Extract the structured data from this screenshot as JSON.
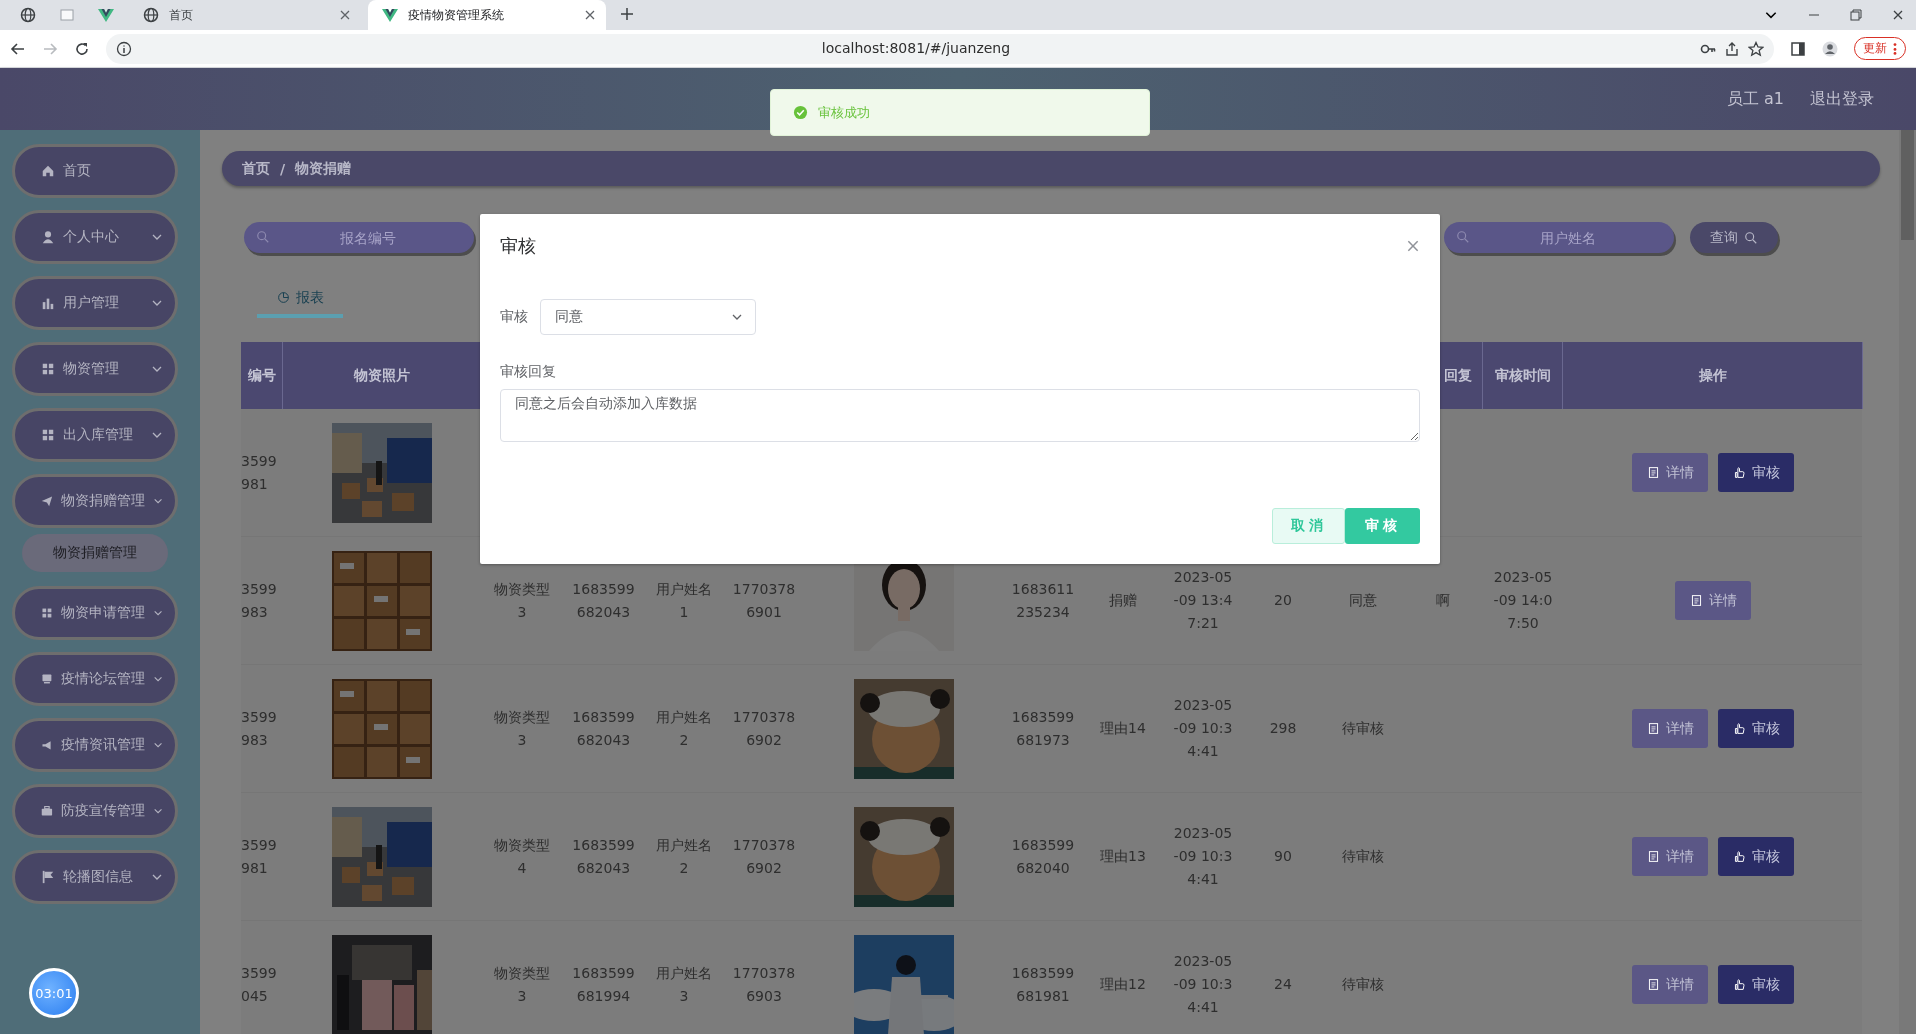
{
  "browser": {
    "tabs": [
      {
        "kind": "pinned-globe",
        "selected": false
      },
      {
        "kind": "pinned-blank",
        "selected": false
      },
      {
        "kind": "pinned-v",
        "selected": false
      },
      {
        "kind": "page",
        "title": "首页",
        "selected": false
      },
      {
        "kind": "v",
        "title": "疫情物资管理系统",
        "selected": true
      }
    ],
    "forward_disabled": true,
    "url": "localhost:8081/#/juanzeng",
    "update_button": "更新"
  },
  "header": {
    "user": "员工 a1",
    "logout": "退出登录"
  },
  "toast": {
    "message": "审核成功"
  },
  "sidebar": {
    "items": [
      {
        "label": "首页",
        "kind": "link"
      },
      {
        "label": "个人中心",
        "kind": "menu"
      },
      {
        "label": "用户管理",
        "kind": "menu"
      },
      {
        "label": "物资管理",
        "kind": "menu"
      },
      {
        "label": "出入库管理",
        "kind": "menu"
      },
      {
        "label": "物资捐赠管理",
        "kind": "menu",
        "expanded": true,
        "children": [
          {
            "label": "物资捐赠管理"
          }
        ]
      },
      {
        "label": "物资申请管理",
        "kind": "menu"
      },
      {
        "label": "疫情论坛管理",
        "kind": "menu"
      },
      {
        "label": "疫情资讯管理",
        "kind": "menu"
      },
      {
        "label": "防疫宣传管理",
        "kind": "menu"
      },
      {
        "label": "轮播图信息",
        "kind": "menu"
      }
    ]
  },
  "timer": "03:01",
  "breadcrumb": {
    "items": [
      "首页",
      "物资捐赠"
    ],
    "separator": "/"
  },
  "search": {
    "fields": [
      {
        "placeholder": "报名编号"
      },
      {
        "placeholder": "用户姓名"
      }
    ],
    "button": "查询"
  },
  "tabs": [
    {
      "label": "报表",
      "selected": true
    }
  ],
  "table": {
    "columns": [
      "编号",
      "物资照片",
      "回复",
      "审核时间",
      "操作"
    ],
    "rows": [
      {
        "id": "3599\n981",
        "actions": [
          {
            "label": "详情",
            "kind": "detail"
          },
          {
            "label": "审核",
            "kind": "audit"
          }
        ]
      },
      {
        "id": "3599\n983",
        "column_3": "物资类型\n3",
        "column_4": "1683599\n682043",
        "column_5": "用户姓名\n1",
        "column_6": "1770378\n6901",
        "column_8": "1683611\n235234",
        "column_9": "捐赠",
        "column_10": "2023-05\n-09 13:4\n7:21",
        "column_11": "20",
        "column_12": "同意",
        "reply": "啊",
        "audit_time": "2023-05\n-09 14:0\n7:50",
        "actions": [
          {
            "label": "详情",
            "kind": "detail"
          }
        ]
      },
      {
        "id": "3599\n983",
        "column_3": "物资类型\n3",
        "column_4": "1683599\n682043",
        "column_5": "用户姓名\n2",
        "column_6": "1770378\n6902",
        "column_8": "1683599\n681973",
        "column_9": "理由14",
        "column_10": "2023-05\n-09 10:3\n4:41",
        "column_11": "298",
        "column_12": "待审核",
        "actions": [
          {
            "label": "详情",
            "kind": "detail"
          },
          {
            "label": "审核",
            "kind": "audit"
          }
        ]
      },
      {
        "id": "3599\n981",
        "column_3": "物资类型\n4",
        "column_4": "1683599\n682043",
        "column_5": "用户姓名\n2",
        "column_6": "1770378\n6902",
        "column_8": "1683599\n682040",
        "column_9": "理由13",
        "column_10": "2023-05\n-09 10:3\n4:41",
        "column_11": "90",
        "column_12": "待审核",
        "actions": [
          {
            "label": "详情",
            "kind": "detail"
          },
          {
            "label": "审核",
            "kind": "audit"
          }
        ]
      },
      {
        "id": "3599\n045",
        "column_3": "物资类型\n3",
        "column_4": "1683599\n681994",
        "column_5": "用户姓名\n3",
        "column_6": "1770378\n6903",
        "column_8": "1683599\n681981",
        "column_9": "理由12",
        "column_10": "2023-05\n-09 10:3\n4:41",
        "column_11": "24",
        "column_12": "待审核",
        "actions": [
          {
            "label": "详情",
            "kind": "detail"
          },
          {
            "label": "审核",
            "kind": "audit"
          }
        ]
      }
    ]
  },
  "dialog": {
    "title": "审核",
    "fields": [
      {
        "kind": "select",
        "label": "审核",
        "value": "同意"
      },
      {
        "kind": "textarea",
        "label": "审核回复",
        "value": "同意之后会自动添加入库数据"
      }
    ],
    "buttons": [
      {
        "label": "取消",
        "kind": "cancel"
      },
      {
        "label": "审核",
        "kind": "primary"
      }
    ]
  }
}
